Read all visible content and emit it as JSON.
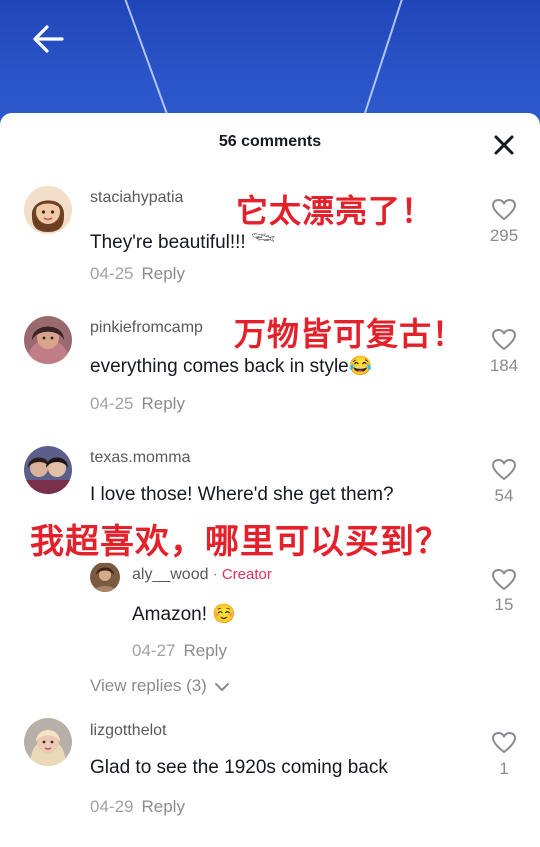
{
  "header": {
    "comments_count": "56 comments"
  },
  "comments": [
    {
      "username": "staciahypatia",
      "text": "They're beautiful!!! 𓆝",
      "date": "04-25",
      "reply_label": "Reply",
      "likes": "295"
    },
    {
      "username": "pinkiefromcamp",
      "text": "everything comes back in style😂",
      "date": "04-25",
      "reply_label": "Reply",
      "likes": "184"
    },
    {
      "username": "texas.momma",
      "text": "I love those! Where'd she get them?",
      "likes": "54"
    },
    {
      "username": "lizgotthelot",
      "text": "Glad to see the 1920s coming back",
      "date": "04-29",
      "reply_label": "Reply",
      "likes": "1"
    }
  ],
  "reply": {
    "username": "aly__wood",
    "separator": "·",
    "badge": "Creator",
    "text": "Amazon! ☺️",
    "date": "04-27",
    "reply_label": "Reply",
    "likes": "15"
  },
  "view_replies": "View replies (3)",
  "overlays": [
    "它太漂亮了！",
    "万物皆可复古！",
    "我超喜欢，哪里可以买到？"
  ],
  "colors": {
    "accent_red": "#e4202a",
    "creator_pink": "#e0315a",
    "video_blue": "#2a55c8"
  }
}
